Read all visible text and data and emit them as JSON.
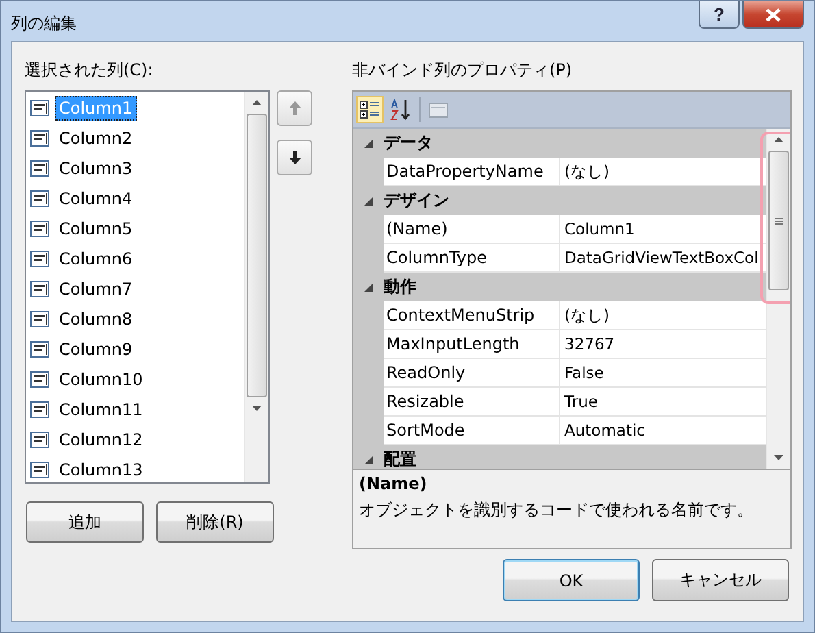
{
  "window": {
    "title": "列の編集",
    "help": "?"
  },
  "columns_panel": {
    "label": "選択された列(C):",
    "items": [
      {
        "label": "Column1",
        "selected": true
      },
      {
        "label": "Column2",
        "selected": false
      },
      {
        "label": "Column3",
        "selected": false
      },
      {
        "label": "Column4",
        "selected": false
      },
      {
        "label": "Column5",
        "selected": false
      },
      {
        "label": "Column6",
        "selected": false
      },
      {
        "label": "Column7",
        "selected": false
      },
      {
        "label": "Column8",
        "selected": false
      },
      {
        "label": "Column9",
        "selected": false
      },
      {
        "label": "Column10",
        "selected": false
      },
      {
        "label": "Column11",
        "selected": false
      },
      {
        "label": "Column12",
        "selected": false
      },
      {
        "label": "Column13",
        "selected": false
      }
    ],
    "buttons": [
      "追加",
      "削除(R)"
    ]
  },
  "properties_panel": {
    "label": "非バインド列のプロパティ(P)",
    "toolbar": [
      {
        "kind": "categorized",
        "selected": true
      },
      {
        "kind": "alphabetical",
        "selected": false
      },
      {
        "kind": "pages",
        "selected": false
      }
    ],
    "categories": [
      {
        "label": "データ",
        "expanded": true,
        "children": [
          {
            "name": "DataPropertyName",
            "value": "(なし)"
          }
        ]
      },
      {
        "label": "デザイン",
        "expanded": true,
        "children": [
          {
            "name": "(Name)",
            "value": "Column1"
          },
          {
            "name": "ColumnType",
            "value": "DataGridViewTextBoxCol"
          }
        ]
      },
      {
        "label": "動作",
        "expanded": true,
        "children": [
          {
            "name": "ContextMenuStrip",
            "value": "(なし)"
          },
          {
            "name": "MaxInputLength",
            "value": "32767"
          },
          {
            "name": "ReadOnly",
            "value": "False"
          },
          {
            "name": "Resizable",
            "value": "True"
          },
          {
            "name": "SortMode",
            "value": "Automatic"
          }
        ]
      },
      {
        "label": "配置",
        "expanded": true
      }
    ],
    "description": {
      "title": "(Name)",
      "text": "オブジェクトを識別するコードで使われる名前です。"
    }
  },
  "footer_buttons": [
    {
      "label": "OK",
      "default": true
    },
    {
      "label": "キャンセル",
      "default": false
    }
  ]
}
